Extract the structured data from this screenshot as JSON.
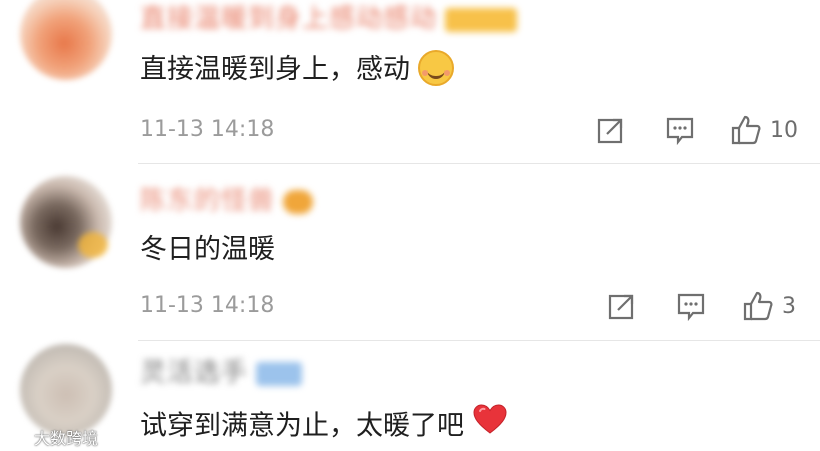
{
  "comments": [
    {
      "username": "",
      "text": "直接温暖到身上，感动",
      "emoji": "smile-icon",
      "time": "11-13 14:18",
      "likes": "10"
    },
    {
      "username": "",
      "text": "冬日的温暖",
      "time": "11-13 14:18",
      "likes": "3"
    },
    {
      "username": "",
      "text": "试穿到满意为止，太暖了吧",
      "emoji": "heart-icon"
    }
  ],
  "watermark": "大数跨境",
  "colors": {
    "heart": "#e8333a",
    "icon": "#6f6f6f",
    "divider": "#e6e6e6"
  }
}
